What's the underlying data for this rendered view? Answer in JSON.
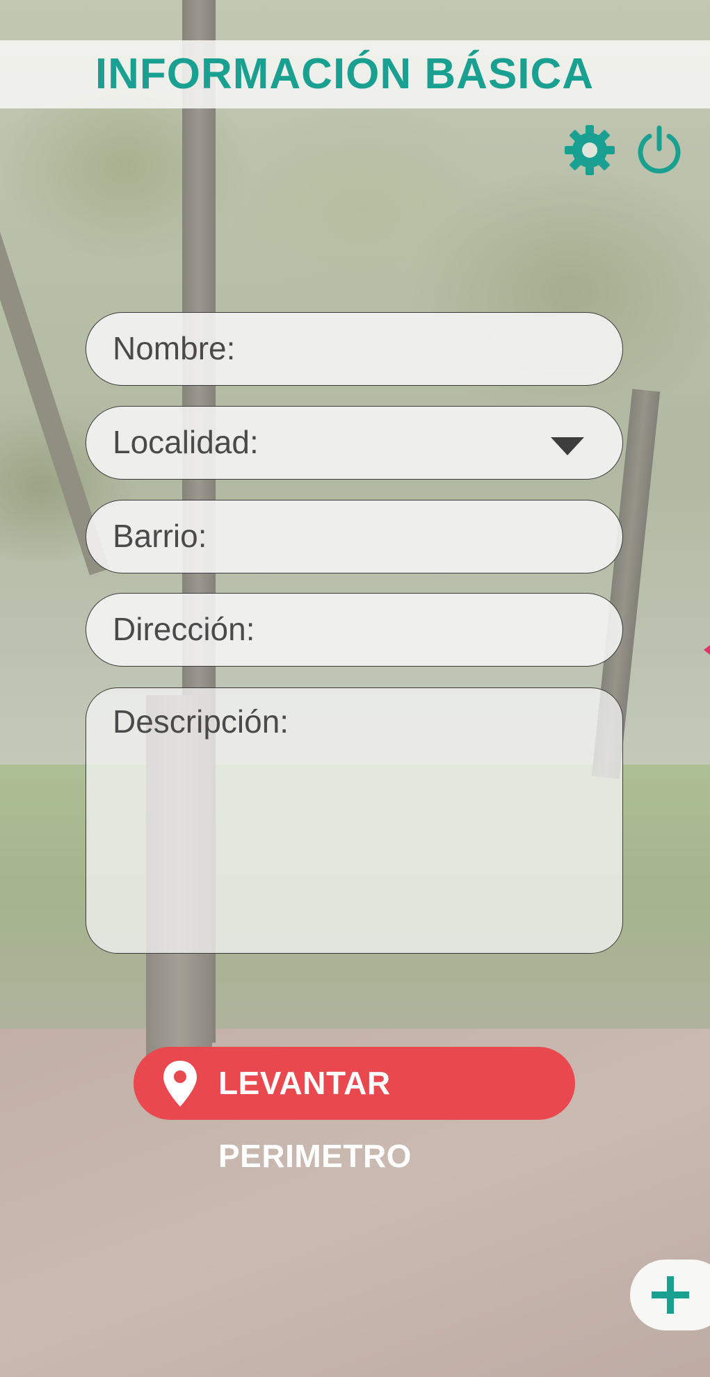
{
  "header": {
    "title": "INFORMACIÓN BÁSICA"
  },
  "toolbar": {
    "settings_icon": "gear-icon",
    "power_icon": "power-icon"
  },
  "form": {
    "nombre_label": "Nombre:",
    "localidad_label": "Localidad:",
    "barrio_label": "Barrio:",
    "direccion_label": "Dirección:",
    "descripcion_label": "Descripción:"
  },
  "cta": {
    "label": "LEVANTAR PERIMETRO",
    "icon": "map-pin-icon"
  },
  "fab": {
    "icon": "plus-icon"
  },
  "colors": {
    "accent": "#1aa090",
    "cta": "#e9484f",
    "field_bg": "#f6f6f6",
    "label_text": "#4a4a4a"
  }
}
